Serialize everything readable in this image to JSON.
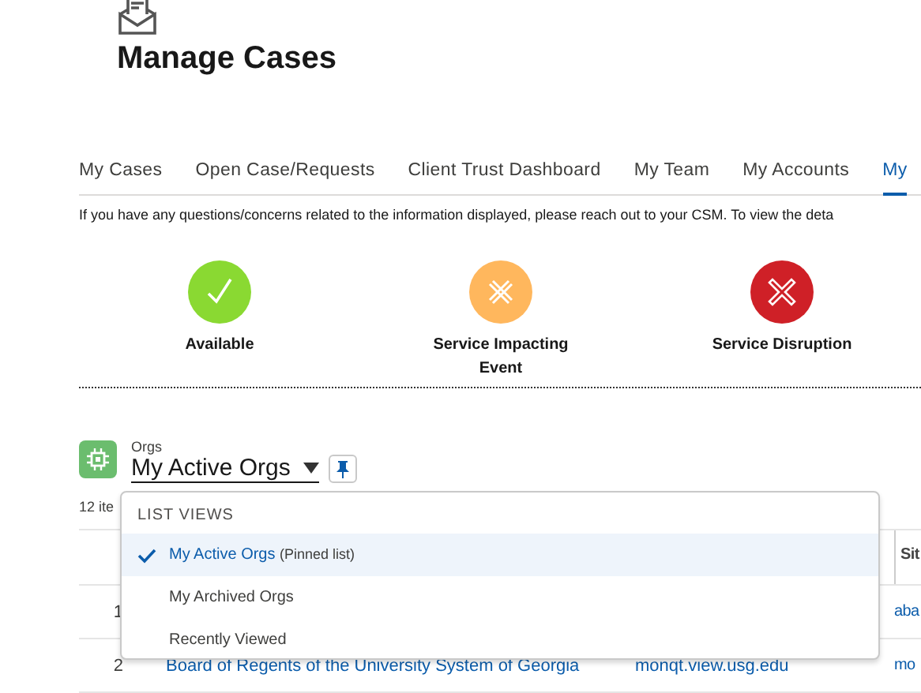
{
  "page": {
    "title": "Manage Cases"
  },
  "tabs": [
    {
      "label": "My Cases",
      "selected": false
    },
    {
      "label": "Open Case/Requests",
      "selected": false
    },
    {
      "label": "Client Trust Dashboard",
      "selected": false
    },
    {
      "label": "My Team",
      "selected": false
    },
    {
      "label": "My Accounts",
      "selected": false
    },
    {
      "label": "My",
      "selected": true
    }
  ],
  "notice": "If you have any questions/concerns related to the information displayed, please reach out to your CSM. To view the deta",
  "status_legend": [
    {
      "kind": "available",
      "label": "Available",
      "color": "#8ad932"
    },
    {
      "kind": "impacting",
      "label": "Service Impacting Event",
      "color": "#ffb75d"
    },
    {
      "kind": "disruption",
      "label": "Service Disruption",
      "color": "#cf2027"
    }
  ],
  "list_header": {
    "object": "Orgs",
    "view": "My Active Orgs",
    "item_count": "12 ite"
  },
  "table": {
    "columns": [
      {},
      {},
      {
        "label": "Sit"
      }
    ],
    "rows": [
      {
        "number": "1",
        "cells": [
          "",
          "",
          "aba"
        ]
      },
      {
        "number": "2",
        "cells": [
          "Board of Regents of the University System of Georgia",
          "monqt.view.usg.edu",
          "mo"
        ]
      }
    ]
  },
  "dropdown": {
    "heading": "LIST VIEWS",
    "items": [
      {
        "label": "My Active Orgs",
        "note": "(Pinned list)",
        "selected": true
      },
      {
        "label": "My Archived Orgs",
        "selected": false
      },
      {
        "label": "Recently Viewed",
        "selected": false
      }
    ]
  }
}
